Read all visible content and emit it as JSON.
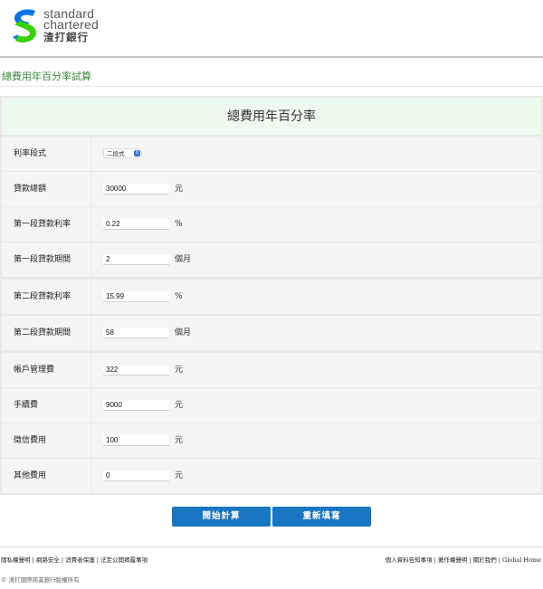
{
  "brand": {
    "name_line1": "standard",
    "name_line2": "chartered",
    "name_chinese": "渣打銀行",
    "colors": {
      "blue": "#0473ea",
      "green": "#38d200"
    }
  },
  "page_title": "總費用年百分率試算",
  "form": {
    "heading": "總費用年百分率",
    "fields": [
      {
        "label": "利率段式",
        "type": "select",
        "value": "二段式"
      },
      {
        "label": "貸款總額",
        "type": "input",
        "value": "30000",
        "unit": "元"
      },
      {
        "label": "第一段貸款利率",
        "type": "input",
        "value": "0.22",
        "unit": "%"
      },
      {
        "label": "第一段貸款期間",
        "type": "input",
        "value": "2",
        "unit": "個月"
      },
      {
        "label": "第二段貸款利率",
        "type": "input",
        "value": "15.99",
        "unit": "%"
      },
      {
        "label": "第二段貸款期間",
        "type": "input",
        "value": "58",
        "unit": "個月"
      },
      {
        "label": "帳戶管理費",
        "type": "input",
        "value": "322",
        "unit": "元"
      },
      {
        "label": "手續費",
        "type": "input",
        "value": "9000",
        "unit": "元"
      },
      {
        "label": "徵信費用",
        "type": "input",
        "value": "100",
        "unit": "元"
      },
      {
        "label": "其他費用",
        "type": "input",
        "value": "0",
        "unit": "元"
      }
    ]
  },
  "buttons": {
    "calculate": "開始計算",
    "reset": "重新填寫"
  },
  "footer": {
    "left_links": "隱私權聲明 | 網路安全 | 消費者保護 | 法定公開揭露事項",
    "right_links": "個人資料告知事項 | 著作權聲明 | 關於我們 | Global Home",
    "copyright": "© 渣打國際商業銀行版權所有"
  }
}
